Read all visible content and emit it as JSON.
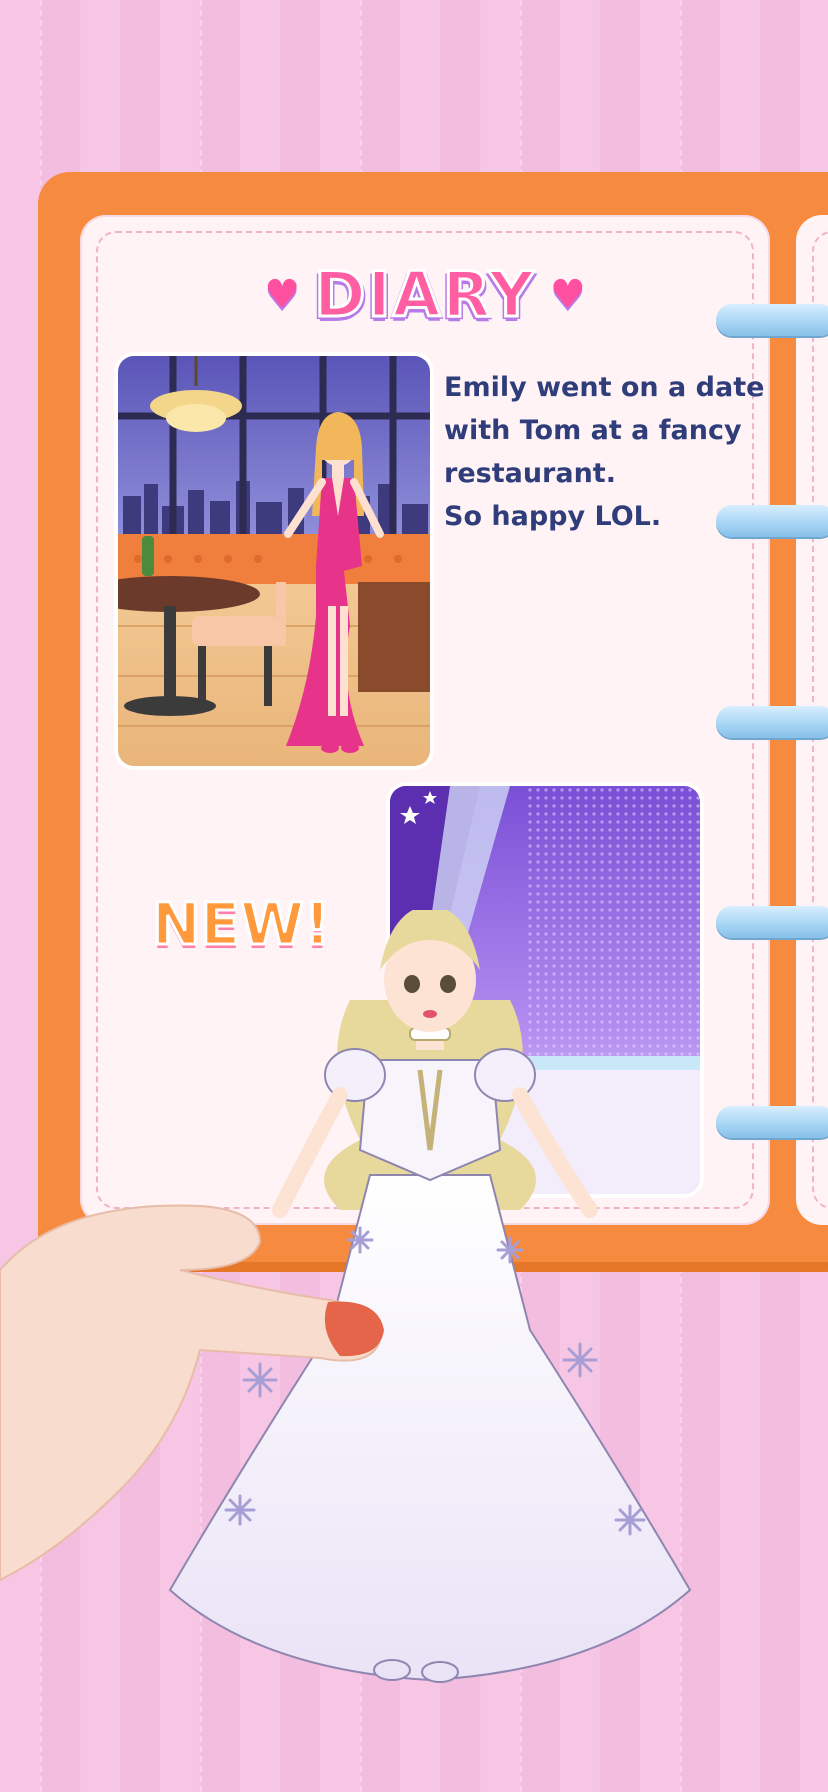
{
  "diary": {
    "title": "DIARY",
    "entry_text": "Emily went on a date\nwith Tom at a fancy\nrestaurant.\nSo happy LOL.",
    "new_badge": "NEW!"
  },
  "colors": {
    "background_pink": "#f7c6e4",
    "notebook_orange": "#f68a3e",
    "page_cream": "#fff3f6",
    "title_pink": "#ff5fa2",
    "text_navy": "#2f3d7a",
    "ring_blue": "#a9d6f5"
  },
  "icons": [
    "heart-icon",
    "star-icon",
    "snowflake-icon"
  ]
}
